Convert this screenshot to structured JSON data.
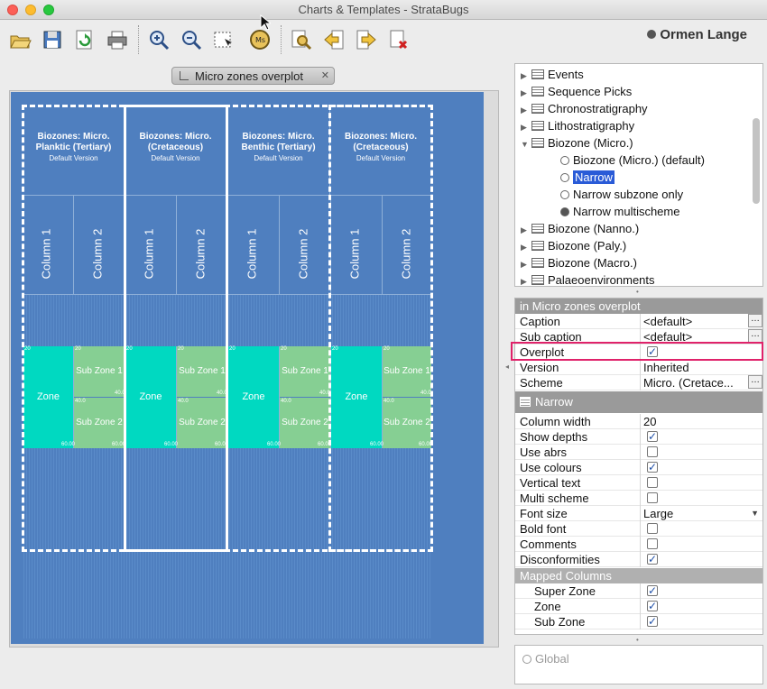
{
  "window": {
    "title": "Charts & Templates - StrataBugs"
  },
  "toolbar": {
    "project": "Ormen Lange",
    "icons": [
      "open-icon",
      "save-icon",
      "refresh-icon",
      "print-icon",
      "zoom-in-icon",
      "zoom-out-icon",
      "select-area-icon",
      "zoom-value-icon",
      "find-icon",
      "move-left-icon",
      "move-right-icon",
      "delete-icon"
    ]
  },
  "chart_tab": {
    "label": "Micro zones overplot"
  },
  "chart": {
    "columns": [
      {
        "title": "Biozones: Micro. Planktic (Tertiary)",
        "version": "Default Version"
      },
      {
        "title": "Biozones: Micro. (Cretaceous)",
        "version": "Default Version"
      },
      {
        "title": "Biozones: Micro. Benthic (Tertiary)",
        "version": "Default Version"
      },
      {
        "title": "Biozones: Micro. (Cretaceous)",
        "version": "Default Version"
      }
    ],
    "sub_columns": [
      "Column 1",
      "Column 2"
    ],
    "zone_label": "Zone",
    "subzone1_label": "Sub Zone 1",
    "subzone2_label": "Sub Zone 2",
    "depth_top": "20",
    "depth_mid": "40.0",
    "depth_mid2": "40.0",
    "depth_bottom": "60.00"
  },
  "tree": {
    "items": [
      {
        "label": "Events",
        "kind": "folder",
        "expanded": false
      },
      {
        "label": "Sequence Picks",
        "kind": "folder",
        "expanded": false
      },
      {
        "label": "Chronostratigraphy",
        "kind": "folder",
        "expanded": false
      },
      {
        "label": "Lithostratigraphy",
        "kind": "folder",
        "expanded": false
      },
      {
        "label": "Biozone (Micro.)",
        "kind": "folder",
        "expanded": true
      },
      {
        "label": "Biozone (Micro.) (default)",
        "kind": "radio"
      },
      {
        "label": "Narrow",
        "kind": "radio",
        "selected": true
      },
      {
        "label": "Narrow subzone only",
        "kind": "radio"
      },
      {
        "label": "Narrow multischeme",
        "kind": "radio",
        "filled": true
      },
      {
        "label": "Biozone (Nanno.)",
        "kind": "folder",
        "expanded": false
      },
      {
        "label": "Biozone (Paly.)",
        "kind": "folder",
        "expanded": false
      },
      {
        "label": "Biozone (Macro.)",
        "kind": "folder",
        "expanded": false
      },
      {
        "label": "Palaeoenvironments",
        "kind": "folder",
        "expanded": false
      }
    ]
  },
  "props": {
    "header1": "in Micro zones overplot",
    "caption_label": "Caption",
    "caption_value": "<default>",
    "subcaption_label": "Sub caption",
    "subcaption_value": "<default>",
    "overplot_label": "Overplot",
    "overplot_checked": true,
    "version_label": "Version",
    "version_value": "Inherited",
    "scheme_label": "Scheme",
    "scheme_value": "Micro. (Cretace...",
    "header2": "Narrow",
    "rows": [
      {
        "label": "Column width",
        "value": "20"
      },
      {
        "label": "Show depths",
        "checked": true
      },
      {
        "label": "Use abrs",
        "checked": false
      },
      {
        "label": "Use colours",
        "checked": true
      },
      {
        "label": "Vertical text",
        "checked": false
      },
      {
        "label": "Multi scheme",
        "checked": false
      },
      {
        "label": "Font size",
        "value": "Large",
        "dropdown": true
      },
      {
        "label": "Bold font",
        "checked": false
      },
      {
        "label": "Comments",
        "checked": false
      },
      {
        "label": "Disconformities",
        "checked": true
      }
    ],
    "header3": "Mapped Columns",
    "mapped": [
      {
        "label": "Super Zone",
        "checked": true
      },
      {
        "label": "Zone",
        "checked": true
      },
      {
        "label": "Sub Zone",
        "checked": true
      }
    ]
  },
  "global": {
    "label": "Global"
  },
  "colors": {
    "canvas": "#4f7fbf",
    "zone": "#00d9c1",
    "subzone": "#86cf93",
    "selection": "#2a5bd7",
    "highlight": "#e0226a"
  }
}
